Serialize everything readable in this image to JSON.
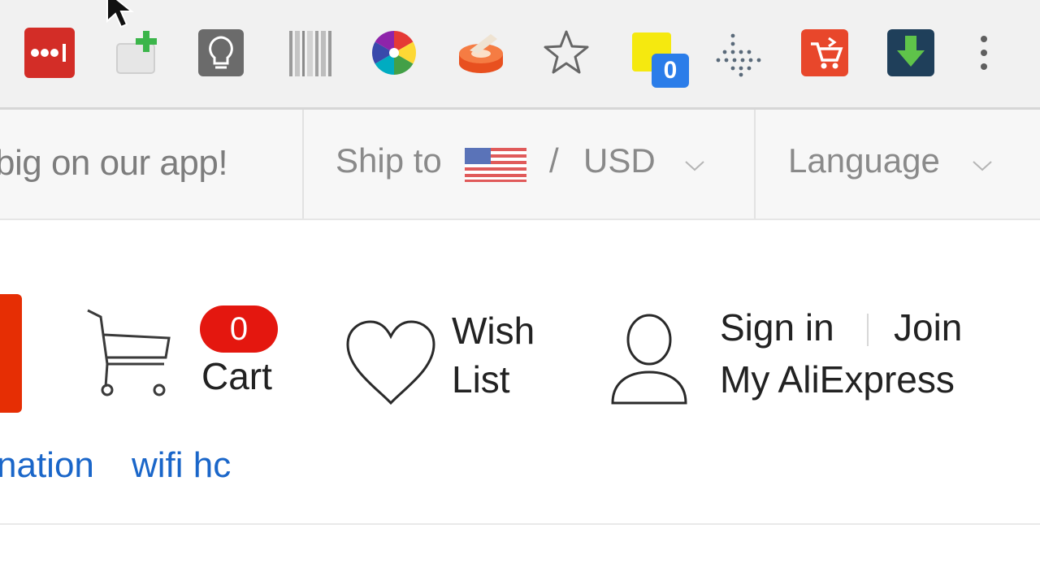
{
  "toolbar": {
    "extensions": [
      {
        "icon": "lastpass-icon",
        "color": "#d32d27"
      },
      {
        "icon": "add-tab-icon"
      },
      {
        "icon": "lightbulb-icon"
      },
      {
        "icon": "barcode-icon"
      },
      {
        "icon": "color-wheel-icon"
      },
      {
        "icon": "tape-icon"
      },
      {
        "icon": "bookmark-star-icon"
      },
      {
        "icon": "sticky-note-icon",
        "badge": "0"
      },
      {
        "icon": "dot-grid-icon"
      },
      {
        "icon": "cart-arrow-icon",
        "color": "#e8472b"
      },
      {
        "icon": "download-arrow-icon",
        "color": "#1f3f5a"
      },
      {
        "icon": "more-menu-icon"
      }
    ]
  },
  "topbar": {
    "promo_text": "big on our app!",
    "ship_to_label": "Ship to",
    "flag": "us-flag-icon",
    "slash": "/",
    "currency": "USD",
    "language_label": "Language"
  },
  "header": {
    "cart_count": "0",
    "cart_label": "Cart",
    "wish_line1": "Wish",
    "wish_line2": "List",
    "sign_in": "Sign in",
    "join": "Join",
    "my_account": "My AliExpress"
  },
  "keywords": [
    "nation",
    "wifi hc"
  ],
  "colors": {
    "brand_red": "#e62e04",
    "link_blue": "#1a66c9",
    "badge_blue": "#2b7de9"
  }
}
